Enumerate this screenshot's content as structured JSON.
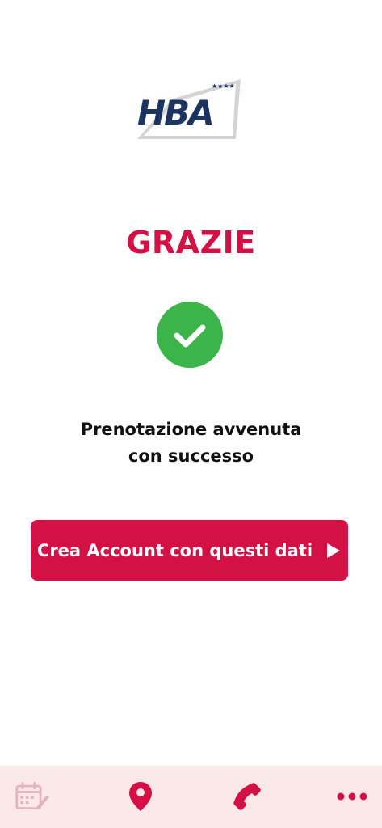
{
  "logo": {
    "text": "HBA",
    "stars": "★★★★",
    "icon": "hba-logo"
  },
  "title": "GRAZIE",
  "success_icon": "check-circle-icon",
  "message": {
    "line1": "Prenotazione avvenuta",
    "line2": "con successo"
  },
  "cta": {
    "label": "Crea Account con questi dati",
    "icon": "play-arrow-icon"
  },
  "bottom_nav": {
    "items": [
      {
        "icon": "calendar-edit-icon",
        "active": false
      },
      {
        "icon": "location-pin-icon",
        "active": true
      },
      {
        "icon": "phone-icon",
        "active": true
      },
      {
        "icon": "more-dots-icon",
        "active": true
      }
    ]
  },
  "colors": {
    "accent": "#d31145",
    "success": "#3bb54a",
    "logo_navy": "#1c3560",
    "logo_grey": "#c8c8c8",
    "nav_background": "#fbe9ea",
    "inactive_icon": "#e4b3bd"
  }
}
